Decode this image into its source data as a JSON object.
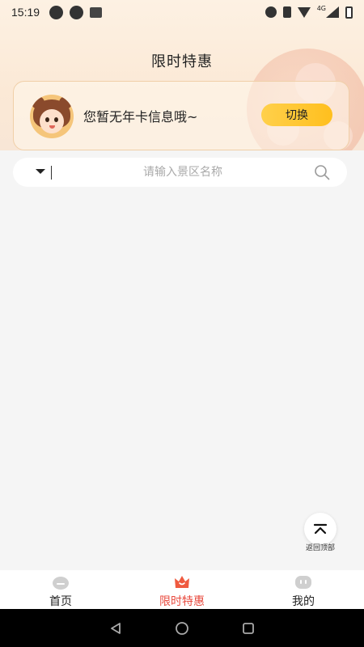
{
  "status_bar": {
    "time": "15:19",
    "network": "4G"
  },
  "header": {
    "title": "限时特惠"
  },
  "card": {
    "message": "您暂无年卡信息哦~",
    "switch_label": "切换"
  },
  "search": {
    "placeholder": "请输入景区名称"
  },
  "back_to_top": {
    "label": "返回顶部"
  },
  "tab_bar": {
    "tabs": [
      {
        "label": "首页",
        "icon": "home-icon",
        "active": false
      },
      {
        "label": "限时特惠",
        "icon": "sale-icon",
        "active": true
      },
      {
        "label": "我的",
        "icon": "profile-icon",
        "active": false
      }
    ]
  },
  "colors": {
    "accent": "#e8493d",
    "button": "#ffc62a",
    "header_bg": "#fbe9d6"
  }
}
